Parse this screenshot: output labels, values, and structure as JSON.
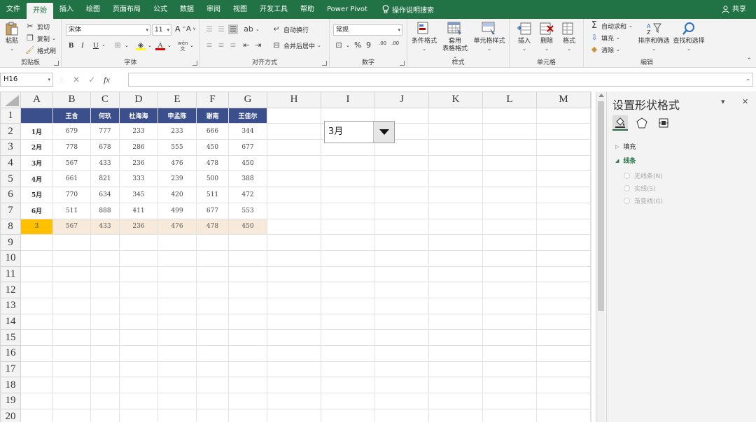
{
  "tabs": [
    "文件",
    "开始",
    "插入",
    "绘图",
    "页面布局",
    "公式",
    "数据",
    "审阅",
    "视图",
    "开发工具",
    "帮助",
    "Power Pivot"
  ],
  "active_tab": 1,
  "tell_me": "操作说明搜索",
  "share": "共享",
  "clipboard": {
    "paste": "粘贴",
    "cut": "剪切",
    "copy": "复制",
    "format_painter": "格式刷",
    "label": "剪贴板"
  },
  "font": {
    "name": "宋体",
    "size": "11",
    "grow": "A",
    "shrink": "A",
    "bold": "B",
    "italic": "I",
    "underline": "U",
    "wen": "wén",
    "label": "字体"
  },
  "alignment": {
    "wrap": "自动换行",
    "merge": "合并后居中",
    "label": "对齐方式"
  },
  "number": {
    "format": "常规",
    "percent": "%",
    "comma": "9",
    "inc": ".00",
    "dec": ".00",
    "label": "数字"
  },
  "styles": {
    "conditional": "条件格式",
    "table_line1": "套用",
    "table_line2": "表格格式",
    "cell_styles": "单元格样式",
    "label": "样式"
  },
  "cells": {
    "insert": "插入",
    "delete": "删除",
    "format": "格式",
    "label": "单元格"
  },
  "editing": {
    "autosum": "自动求和",
    "fill": "填充",
    "clear": "清除",
    "sort": "排序和筛选",
    "find": "查找和选择",
    "label": "编辑"
  },
  "name_box": "H16",
  "fx": "fx",
  "columns": [
    "A",
    "B",
    "C",
    "D",
    "E",
    "F",
    "G",
    "H",
    "I",
    "J",
    "K",
    "L",
    "M"
  ],
  "rows": [
    "1",
    "2",
    "3",
    "4",
    "5",
    "6",
    "7",
    "8",
    "9",
    "10",
    "11",
    "12",
    "13",
    "14",
    "15",
    "16",
    "17",
    "18",
    "19",
    "20"
  ],
  "table": {
    "headers": [
      "王含",
      "何玖",
      "杜海海",
      "申孟陈",
      "谢南",
      "王佳尔"
    ],
    "data": [
      {
        "month": "1月",
        "values": [
          "679",
          "777",
          "233",
          "233",
          "666",
          "344"
        ]
      },
      {
        "month": "2月",
        "values": [
          "778",
          "678",
          "286",
          "555",
          "450",
          "677"
        ]
      },
      {
        "month": "3月",
        "values": [
          "567",
          "433",
          "236",
          "476",
          "478",
          "450"
        ]
      },
      {
        "month": "4月",
        "values": [
          "661",
          "821",
          "333",
          "239",
          "500",
          "388"
        ]
      },
      {
        "month": "5月",
        "values": [
          "770",
          "634",
          "345",
          "420",
          "511",
          "472"
        ]
      },
      {
        "month": "6月",
        "values": [
          "511",
          "888",
          "411",
          "499",
          "677",
          "553"
        ]
      }
    ],
    "result_index": "3",
    "result": [
      "567",
      "433",
      "236",
      "476",
      "478",
      "450"
    ]
  },
  "dropdown": {
    "value": "3月"
  },
  "pane": {
    "title": "设置形状格式",
    "fill": "填充",
    "line": "线条",
    "options": [
      "无线条(N)",
      "实线(S)",
      "渐变线(G)"
    ]
  },
  "colors": {
    "excel_green": "#217346",
    "header_blue": "#3a4f8b",
    "selected_yellow": "#ffc000",
    "result_beige": "#f7eadb"
  }
}
